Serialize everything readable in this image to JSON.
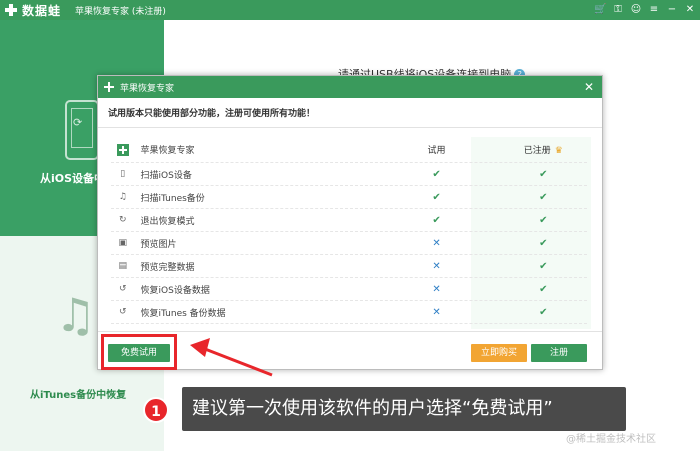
{
  "titlebar": {
    "brand": "数据蛙",
    "app_title": "苹果恢复专家 (未注册)",
    "icons": [
      "cart-icon",
      "key-icon",
      "chat-icon",
      "menu-icon",
      "minimize-icon",
      "close-icon"
    ]
  },
  "left": {
    "ios_label": "从iOS设备中",
    "itunes_label": "从iTunes备份中恢复"
  },
  "main": {
    "hint": "请通过USB线将iOS设备连接到电脑"
  },
  "dialog": {
    "title": "苹果恢复专家",
    "notice": "试用版本只能使用部分功能，注册可使用所有功能！",
    "headers": {
      "product": "苹果恢复专家",
      "trial": "试用",
      "registered": "已注册"
    },
    "features": [
      {
        "name": "扫描iOS设备",
        "icon": "phone-icon",
        "trial": true,
        "registered": true
      },
      {
        "name": "扫描iTunes备份",
        "icon": "music-icon",
        "trial": true,
        "registered": true
      },
      {
        "name": "退出恢复模式",
        "icon": "exit-icon",
        "trial": true,
        "registered": true
      },
      {
        "name": "预览图片",
        "icon": "image-icon",
        "trial": false,
        "registered": true
      },
      {
        "name": "预览完整数据",
        "icon": "preview-icon",
        "trial": false,
        "registered": true
      },
      {
        "name": "恢复iOS设备数据",
        "icon": "restore-icon",
        "trial": false,
        "registered": true
      },
      {
        "name": "恢复iTunes 备份数据",
        "icon": "restore-icon",
        "trial": false,
        "registered": true
      }
    ],
    "buttons": {
      "free": "免费试用",
      "buy": "立即购买",
      "register": "注册"
    },
    "close": "✕"
  },
  "annotation": {
    "badge": "1",
    "text": "建议第一次使用该软件的用户选择“免费试用”"
  },
  "watermark": "@稀土掘金技术社区",
  "colors": {
    "brand_green": "#3a9a5c",
    "buy_orange": "#f2a533",
    "highlight_red": "#e8262b",
    "cross_blue": "#2f7fc5"
  }
}
